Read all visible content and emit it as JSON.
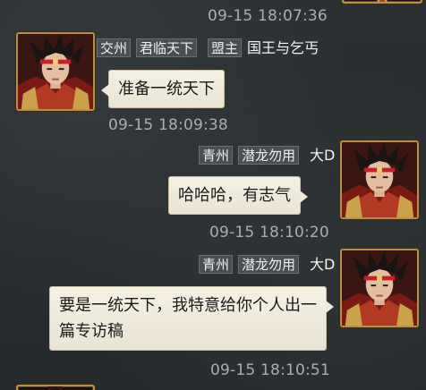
{
  "messages": [
    {
      "timestamp": "09-15 18:07:36"
    },
    {
      "side": "left",
      "tags": [
        "交州",
        "君临天下",
        "盟主"
      ],
      "username": "国王与乞丐",
      "text": "准备一统天下",
      "timestamp": "09-15 18:09:38"
    },
    {
      "side": "right",
      "tags": [
        "青州",
        "潜龙勿用"
      ],
      "username": "大D",
      "text": "哈哈哈，有志气",
      "timestamp": "09-15 18:10:20"
    },
    {
      "side": "right",
      "tags": [
        "青州",
        "潜龙勿用"
      ],
      "username": "大D",
      "text": "要是一统天下，我特意给你个人出一篇专访稿",
      "timestamp": "09-15 18:10:51"
    }
  ],
  "avatar_icon": "warrior-portrait-icon",
  "colors": {
    "frame": "#b88f47",
    "bubble": "#f1ede0",
    "tag_bg": "#4a4e50",
    "timestamp": "#a9aeb0"
  }
}
